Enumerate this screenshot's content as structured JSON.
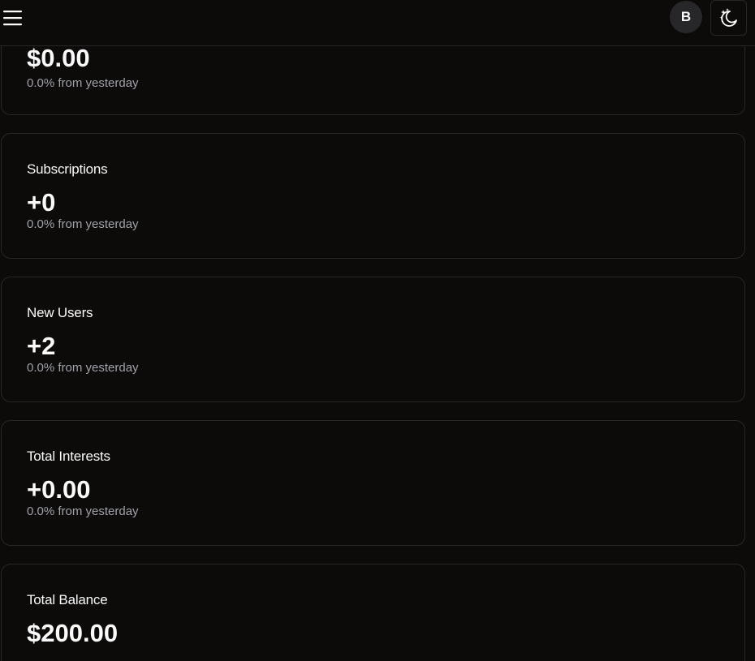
{
  "header": {
    "avatar_initial": "B"
  },
  "cards": [
    {
      "title": "",
      "value": "$0.00",
      "change": "0.0% from yesterday"
    },
    {
      "title": "Subscriptions",
      "value": "+0",
      "change": "0.0% from yesterday"
    },
    {
      "title": "New Users",
      "value": "+2",
      "change": "0.0% from yesterday"
    },
    {
      "title": "Total Interests",
      "value": "+0.00",
      "change": "0.0% from yesterday"
    },
    {
      "title": "Total Balance",
      "value": "$200.00",
      "change": ""
    }
  ],
  "icons": {
    "menu": "hamburger-menu-icon",
    "theme": "moon-stars-icon"
  }
}
